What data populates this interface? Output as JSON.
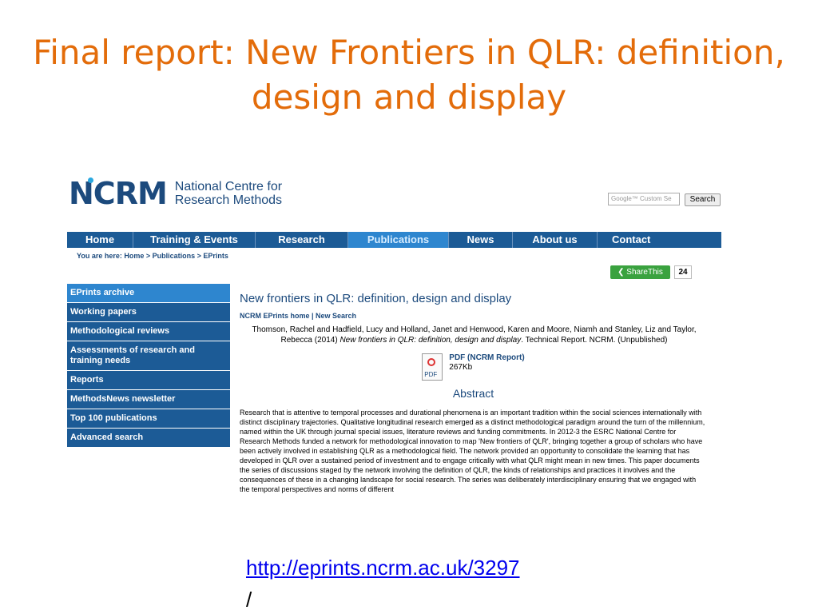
{
  "slide": {
    "title": "Final report: New Frontiers in QLR: definition, design and display",
    "url": "http://eprints.ncrm.ac.uk/3297",
    "url_tail": "/"
  },
  "site": {
    "logo_mark": "NCRM",
    "logo_line1": "National Centre for",
    "logo_line2": "Research Methods",
    "search_placeholder": "Google™ Custom Se",
    "search_button": "Search",
    "nav": [
      "Home",
      "Training & Events",
      "Research",
      "Publications",
      "News",
      "About us",
      "Contact"
    ],
    "nav_active": "Publications",
    "breadcrumb": "You are here: Home > Publications > EPrints",
    "share_label": "ShareThis",
    "share_count": "24",
    "sidebar": [
      "EPrints archive",
      "Working papers",
      "Methodological reviews",
      "Assessments of research and training needs",
      "Reports",
      "MethodsNews newsletter",
      "Top 100 publications",
      "Advanced search"
    ]
  },
  "publication": {
    "title": "New frontiers in QLR: definition, design and display",
    "links": "NCRM EPrints home | New Search",
    "citation_authors": "Thomson, Rachel and Hadfield, Lucy and Holland, Janet and Henwood, Karen and Moore, Niamh and Stanley, Liz and Taylor, Rebecca (2014)",
    "citation_title": "New frontiers in QLR: definition, design and display",
    "citation_tail": ". Technical Report. NCRM. (Unpublished)",
    "pdf_label": "PDF (NCRM Report)",
    "pdf_size": "267Kb",
    "pdf_icon_text": "PDF",
    "abstract_heading": "Abstract",
    "abstract": "Research that is attentive to temporal processes and durational phenomena is an important tradition within the social sciences internationally with distinct disciplinary trajectories. Qualitative longitudinal research emerged as a distinct methodological paradigm around the turn of the millennium, named within the UK through journal special issues, literature reviews and funding commitments. In 2012-3 the ESRC National Centre for Research Methods funded a network for methodological innovation to map 'New frontiers of QLR', bringing together a group of scholars who have been actively involved in establishing QLR as a methodological field. The network provided an opportunity to consolidate the learning that has developed in QLR over a sustained period of investment and to engage critically with what QLR might mean in new times. This paper documents the series of discussions staged by the network involving the definition of QLR, the kinds of relationships and practices it involves and the consequences of these in a changing landscape for social research. The series was deliberately interdisciplinary ensuring that we engaged with the temporal perspectives and norms of different"
  }
}
